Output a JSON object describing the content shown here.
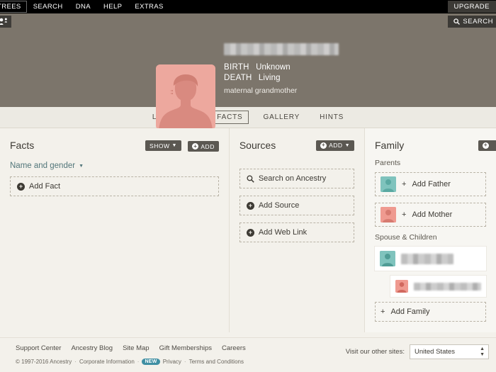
{
  "topnav": {
    "items": [
      {
        "label": "TREES",
        "boxed": true
      },
      {
        "label": "SEARCH",
        "boxed": false
      },
      {
        "label": "DNA",
        "boxed": false
      },
      {
        "label": "HELP",
        "boxed": false
      },
      {
        "label": "EXTRAS",
        "boxed": false
      }
    ],
    "upgrade_label": "UPGRADE"
  },
  "subbar": {
    "tree_icon": "family-tree-icon",
    "search_label": "SEARCH",
    "search_icon": "search-icon"
  },
  "person": {
    "avatar_icon": "female-silhouette-avatar",
    "name": "",
    "name_redacted": true,
    "facts": [
      {
        "label": "BIRTH",
        "value": "Unknown"
      },
      {
        "label": "DEATH",
        "value": "Living"
      }
    ],
    "relationship": "maternal grandmother"
  },
  "tabs": [
    {
      "label": "LIFESTORY",
      "active": false
    },
    {
      "label": "FACTS",
      "active": true
    },
    {
      "label": "GALLERY",
      "active": false
    },
    {
      "label": "HINTS",
      "active": false
    }
  ],
  "facts_panel": {
    "title": "Facts",
    "show_label": "SHOW",
    "add_label": "ADD",
    "group_link": "Name and gender",
    "add_fact_label": "Add Fact"
  },
  "sources_panel": {
    "title": "Sources",
    "add_label": "ADD",
    "items": [
      {
        "label": "Search on Ancestry",
        "icon": "search-icon"
      },
      {
        "label": "Add Source",
        "icon": "plus-icon"
      },
      {
        "label": "Add Web Link",
        "icon": "plus-icon"
      }
    ]
  },
  "family_panel": {
    "title": "Family",
    "parents_label": "Parents",
    "add_father_label": "Add Father",
    "add_mother_label": "Add Mother",
    "spouse_children_label": "Spouse & Children",
    "members": [
      {
        "avatar": "male-silhouette-avatar",
        "name": "",
        "name_redacted": true,
        "indent": false
      },
      {
        "avatar": "female-silhouette-avatar",
        "name": "",
        "name_redacted": true,
        "indent": true
      }
    ],
    "add_family_label": "Add Family"
  },
  "footer": {
    "links": [
      "Support Center",
      "Ancestry Blog",
      "Site Map",
      "Gift Memberships",
      "Careers"
    ],
    "copyright": "© 1997-2016 Ancestry",
    "corporate_label": "Corporate Information",
    "new_badge": "NEW",
    "privacy_label": "Privacy",
    "terms_label": "Terms and Conditions",
    "other_sites_label": "Visit our other sites:",
    "country_selected": "United States"
  },
  "colors": {
    "nav_black": "#000000",
    "hero_tan": "#7c756b",
    "page_bg": "#f3f1eb",
    "accent_teal": "#52767a",
    "female_avatar": "#eda89e",
    "male_avatar": "#7fc3bd",
    "badge_blue": "#3f8fa3"
  }
}
